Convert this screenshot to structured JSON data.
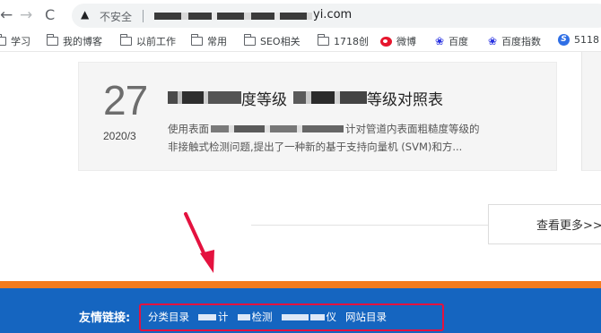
{
  "browser": {
    "insecure_label": "不安全",
    "url_visible": "yi.com",
    "bookmarks": [
      "学习",
      "我的博客",
      "以前工作",
      "常用",
      "SEO相关",
      "1718创",
      "微博",
      "百度",
      "百度指数",
      "5118"
    ]
  },
  "article": {
    "day": "27",
    "year_month": "2020/3",
    "title_part1": "度等级",
    "title_part2": "等级对照表",
    "desc_line1_start": "使用表面",
    "desc_line1_end": "计对管道内表面粗糙度等级的",
    "desc_line2": "非接触式检测问题,提出了一种新的基于支持向量机 (SVM)和方..."
  },
  "more_button": "查看更多>>",
  "footer": {
    "friend_links_label": "友情链接:",
    "links": [
      "分类目录",
      "计",
      "检测",
      "仪",
      "网站目录"
    ]
  },
  "colors": {
    "footer_bg": "#1565c0",
    "footer_accent": "#f37b1d",
    "highlight_box": "#e4123f",
    "arrow": "#e4123f"
  }
}
